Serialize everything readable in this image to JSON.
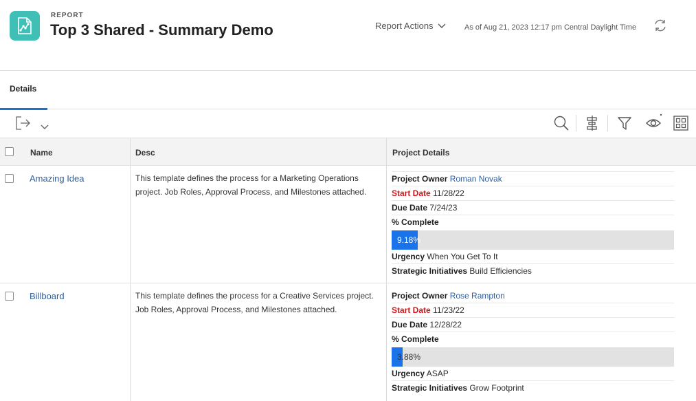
{
  "header": {
    "kicker": "REPORT",
    "title": "Top 3 Shared - Summary Demo",
    "actions_label": "Report Actions",
    "as_of": "As of Aug 21, 2023 12:17 pm Central Daylight Time",
    "icon_color": "#3fbfb5"
  },
  "tabs": [
    {
      "label": "Details",
      "active": true
    }
  ],
  "toolbar": {
    "icons": [
      "export-icon",
      "chevron-down-icon",
      "search-icon",
      "grouping-icon",
      "filter-icon",
      "view-icon",
      "grid-layout-icon"
    ]
  },
  "table": {
    "columns": [
      "Name",
      "Desc",
      "Project Details"
    ],
    "rows": [
      {
        "name": "Amazing Idea",
        "desc": "This template defines the process for a Marketing Operations project. Job Roles, Approval Process, and Milestones attached.",
        "details": {
          "owner_label": "Project Owner",
          "owner": "Roman Novak",
          "start_label": "Start Date",
          "start": "11/28/22",
          "due_label": "Due Date",
          "due": "7/24/23",
          "complete_label": "% Complete",
          "complete_text": "9.18%",
          "complete_value": 9.18,
          "urgency_label": "Urgency",
          "urgency": "When You Get To It",
          "initiatives_label": "Strategic Initiatives",
          "initiatives": "Build Efficiencies"
        }
      },
      {
        "name": "Billboard",
        "desc": "This template defines the process for a Creative Services project. Job Roles, Approval Process, and Milestones attached.",
        "details": {
          "owner_label": "Project Owner",
          "owner": "Rose Rampton",
          "start_label": "Start Date",
          "start": "11/23/22",
          "due_label": "Due Date",
          "due": "12/28/22",
          "complete_label": "% Complete",
          "complete_text": "3.88%",
          "complete_value": 3.88,
          "urgency_label": "Urgency",
          "urgency": "ASAP",
          "initiatives_label": "Strategic Initiatives",
          "initiatives": "Grow Footprint"
        }
      }
    ]
  },
  "colors": {
    "accent": "#1a73e8",
    "link": "#2e5e9e",
    "start_date": "#d7161a"
  }
}
